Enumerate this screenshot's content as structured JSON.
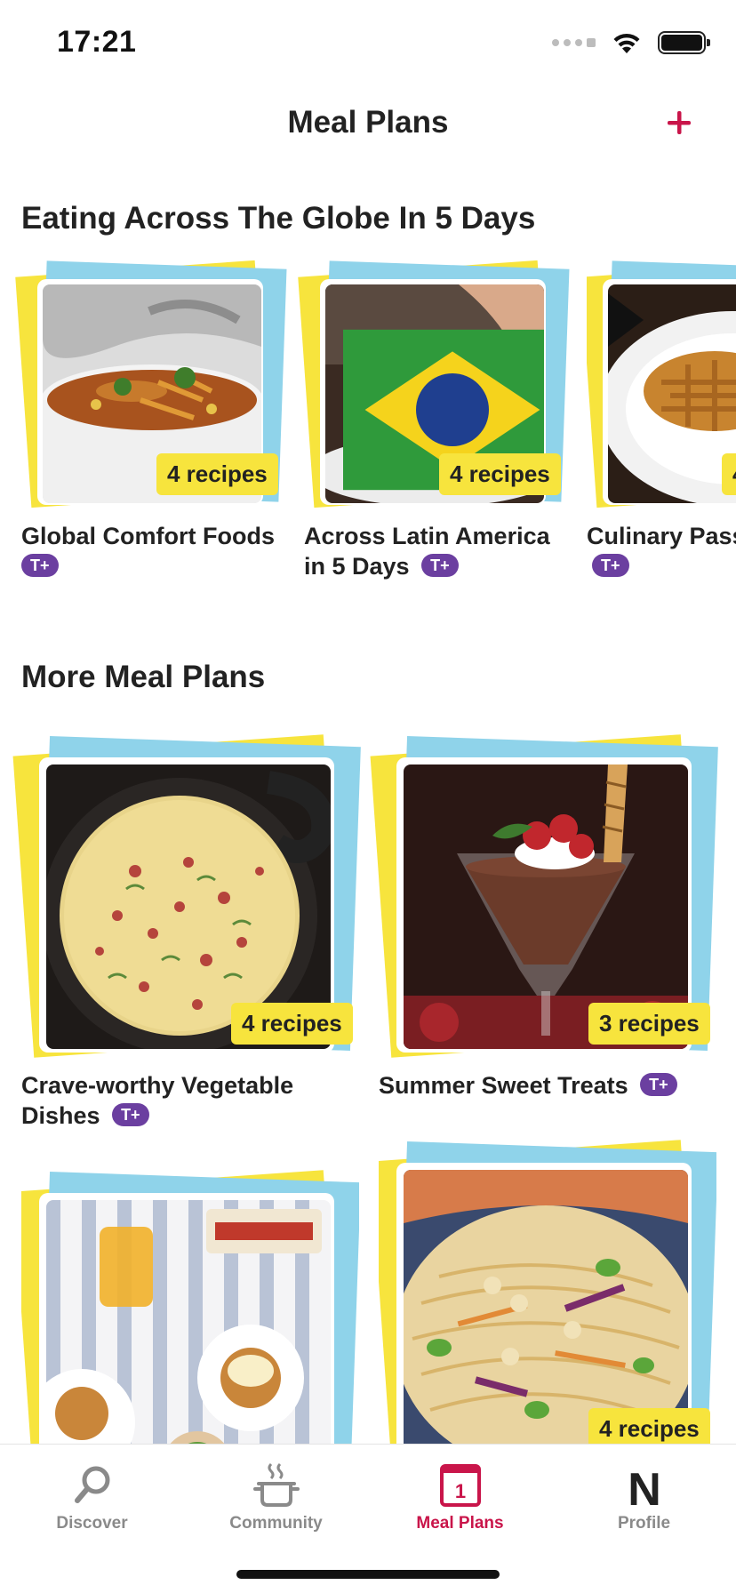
{
  "status_bar": {
    "time": "17:21"
  },
  "header": {
    "title": "Meal Plans",
    "add_icon": "plus-icon",
    "accent_color": "#c9154a"
  },
  "featured": {
    "title": "Eating Across The Globe In 5 Days",
    "items": [
      {
        "title": "Global Comfort Foods",
        "badge": "4 recipes",
        "tier": "T+"
      },
      {
        "title": "Across Latin America in 5 Days",
        "badge": "4 recipes",
        "tier": "T+"
      },
      {
        "title": "Culinary Pass England",
        "badge": "4",
        "tier": "T+"
      }
    ]
  },
  "more": {
    "title": "More Meal Plans",
    "items": [
      {
        "title": "Crave-worthy Vegetable Dishes",
        "badge": "4 recipes",
        "tier": "T+"
      },
      {
        "title": "Summer Sweet Treats",
        "badge": "3 recipes",
        "tier": "T+"
      },
      {
        "title": "",
        "badge": "",
        "tier": ""
      },
      {
        "title": "",
        "badge": "4 recipes",
        "tier": ""
      }
    ]
  },
  "tabs": [
    {
      "label": "Discover",
      "icon": "search-icon"
    },
    {
      "label": "Community",
      "icon": "pot-icon"
    },
    {
      "label": "Meal Plans",
      "icon": "calendar-icon",
      "calendar_day": "1",
      "active": true
    },
    {
      "label": "Profile",
      "icon": "profile-logo-icon",
      "glyph": "N"
    }
  ],
  "colors": {
    "yellow": "#f7e43d",
    "blue": "#8fd3ea",
    "purple": "#6b3fa0",
    "accent": "#c9154a"
  }
}
